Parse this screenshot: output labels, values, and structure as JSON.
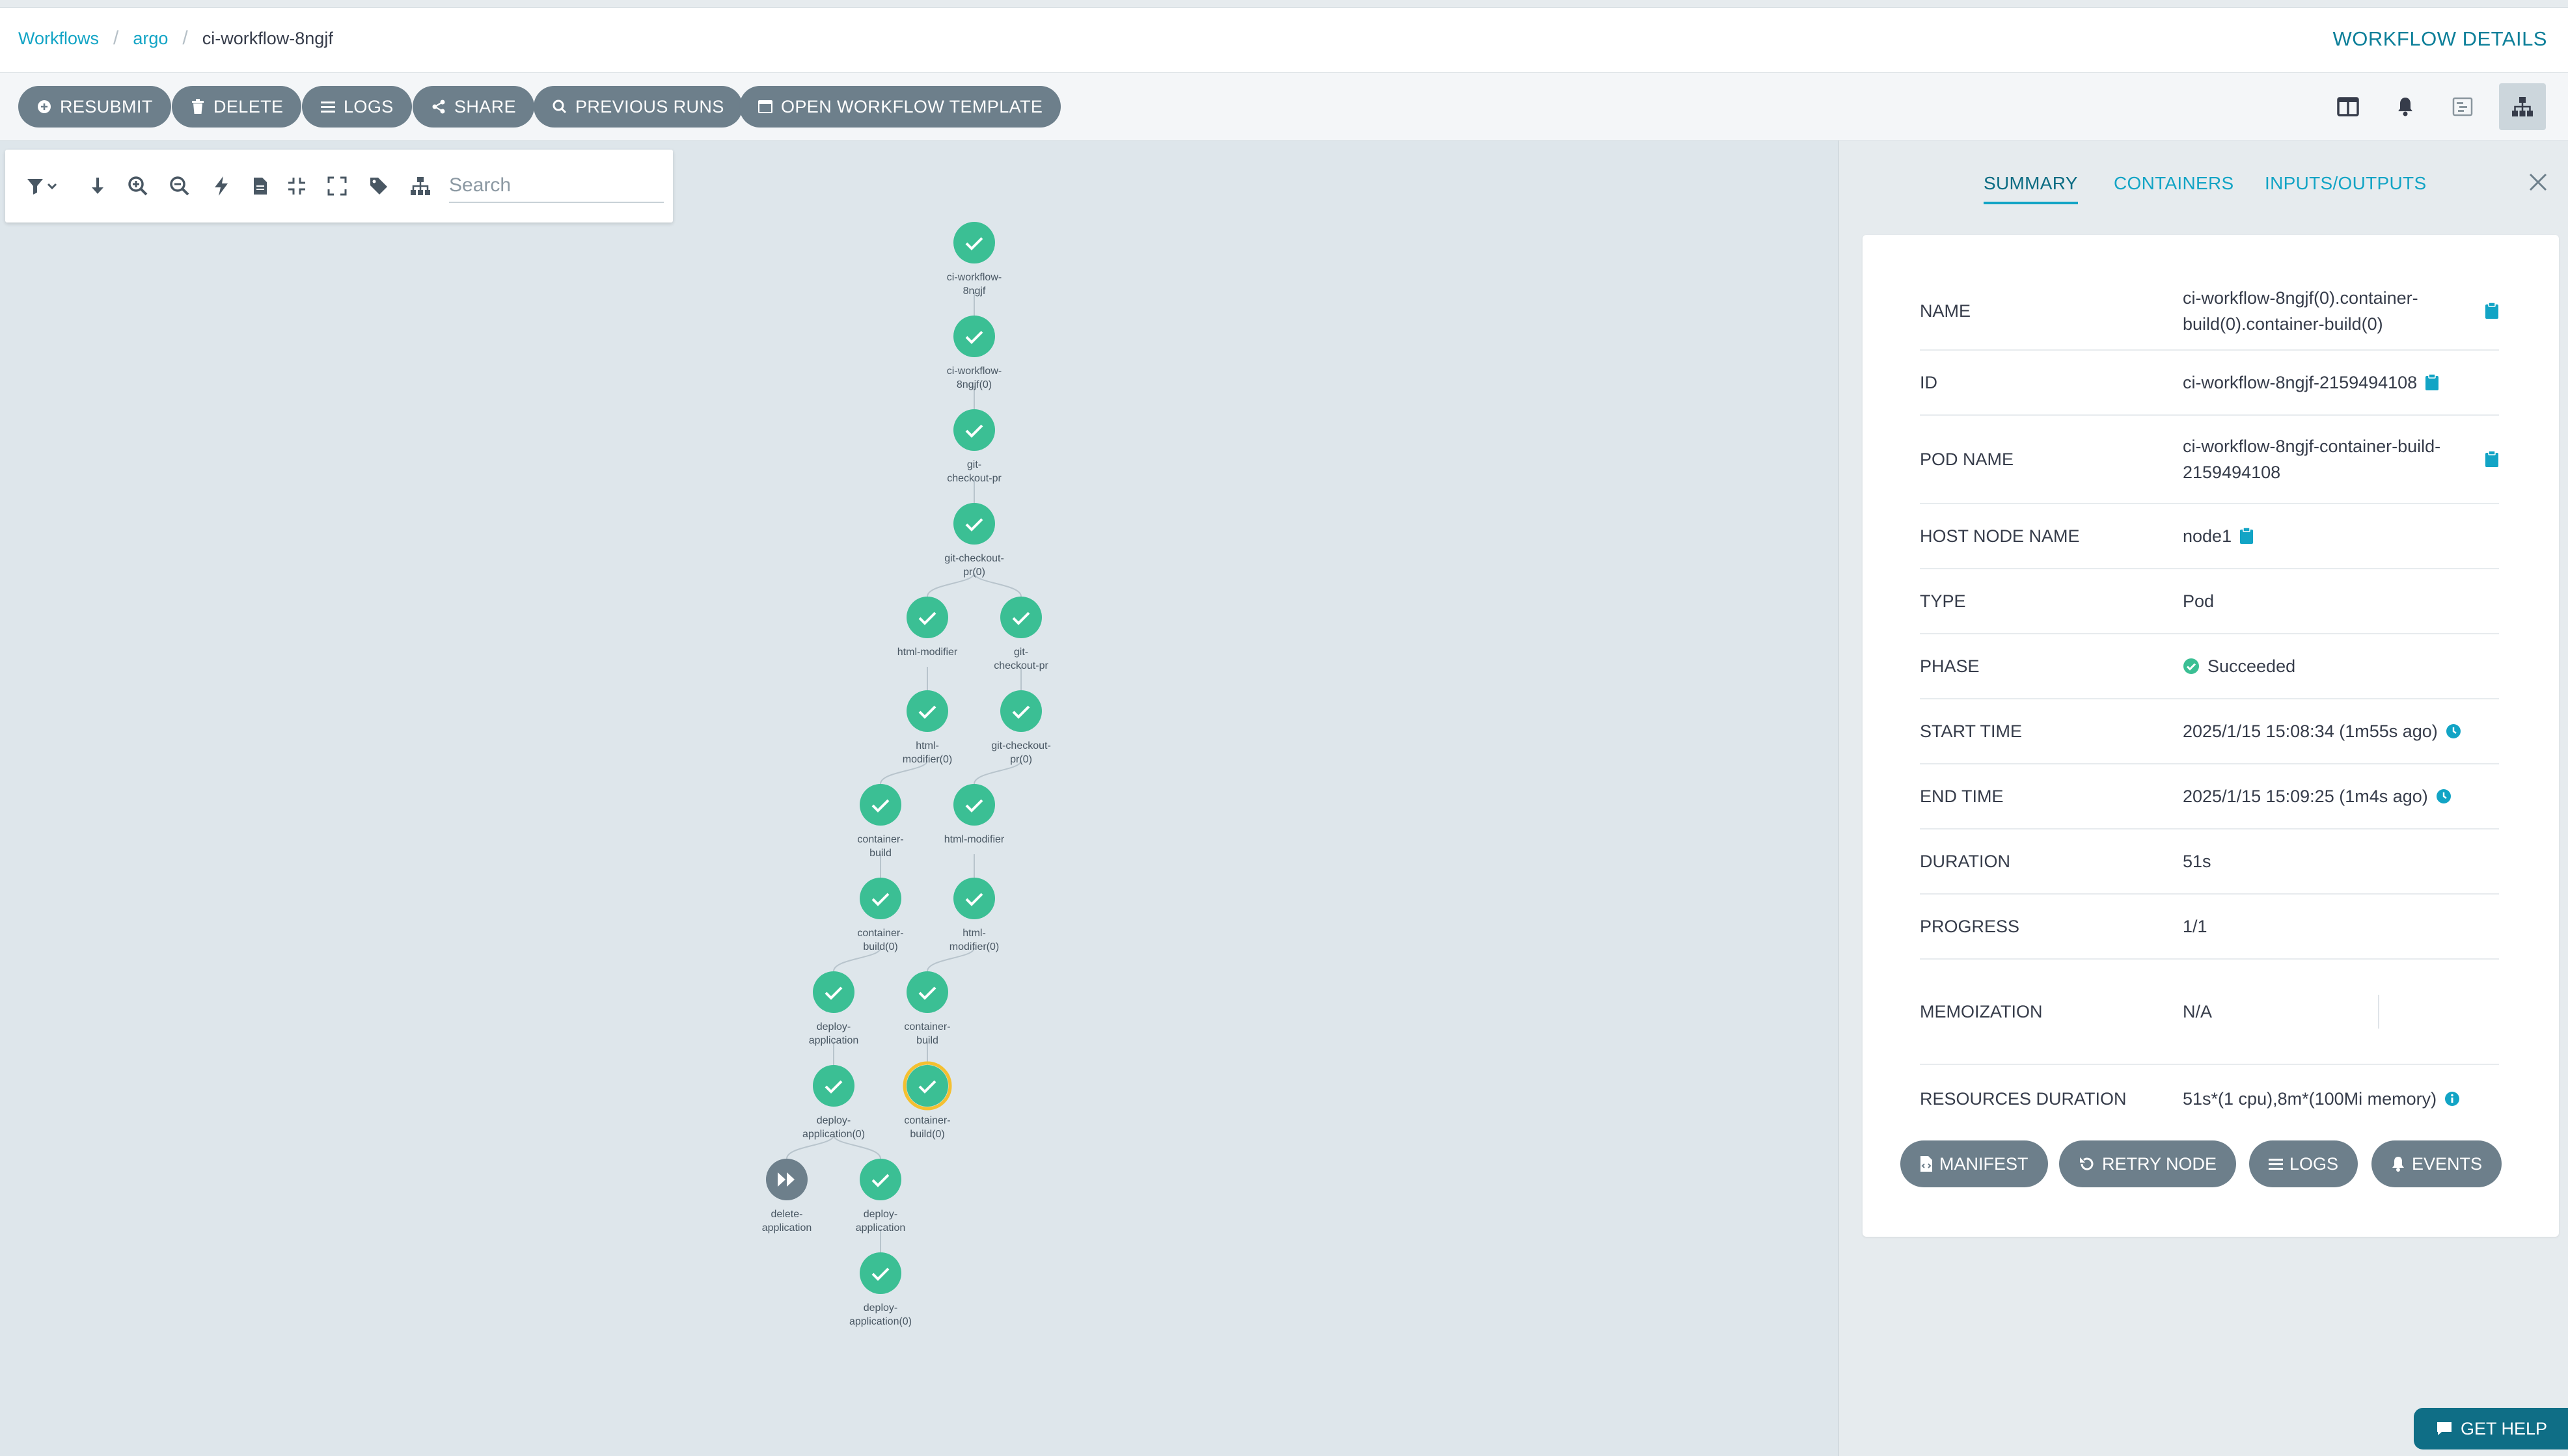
{
  "breadcrumb": {
    "items": [
      "Workflows",
      "argo"
    ],
    "current": "ci-workflow-8ngjf"
  },
  "page_title": "WORKFLOW DETAILS",
  "actions": {
    "resubmit": "RESUBMIT",
    "delete": "DELETE",
    "logs": "LOGS",
    "share": "SHARE",
    "previous_runs": "PREVIOUS RUNS",
    "open_template": "OPEN WORKFLOW TEMPLATE"
  },
  "graph_toolbar": {
    "search_placeholder": "Search"
  },
  "graph": {
    "nodes": [
      {
        "id": "n1",
        "label": [
          "ci-workflow-",
          "8ngjf"
        ],
        "status": "succeeded"
      },
      {
        "id": "n2",
        "label": [
          "ci-workflow-",
          "8ngjf(0)"
        ],
        "status": "succeeded"
      },
      {
        "id": "n3",
        "label": [
          "git-",
          "checkout-pr"
        ],
        "status": "succeeded"
      },
      {
        "id": "n4",
        "label": [
          "git-checkout-",
          "pr(0)"
        ],
        "status": "succeeded"
      },
      {
        "id": "n5",
        "label": [
          "html-modifier"
        ],
        "status": "succeeded"
      },
      {
        "id": "n6",
        "label": [
          "git-",
          "checkout-pr"
        ],
        "status": "succeeded"
      },
      {
        "id": "n7",
        "label": [
          "html-",
          "modifier(0)"
        ],
        "status": "succeeded"
      },
      {
        "id": "n8",
        "label": [
          "git-checkout-",
          "pr(0)"
        ],
        "status": "succeeded"
      },
      {
        "id": "n9",
        "label": [
          "container-",
          "build"
        ],
        "status": "succeeded"
      },
      {
        "id": "n10",
        "label": [
          "html-modifier"
        ],
        "status": "succeeded"
      },
      {
        "id": "n11",
        "label": [
          "container-",
          "build(0)"
        ],
        "status": "succeeded"
      },
      {
        "id": "n12",
        "label": [
          "html-",
          "modifier(0)"
        ],
        "status": "succeeded"
      },
      {
        "id": "n13",
        "label": [
          "deploy-",
          "application"
        ],
        "status": "succeeded"
      },
      {
        "id": "n14",
        "label": [
          "container-",
          "build"
        ],
        "status": "succeeded"
      },
      {
        "id": "n15",
        "label": [
          "deploy-",
          "application(0)"
        ],
        "status": "succeeded"
      },
      {
        "id": "n16",
        "label": [
          "container-",
          "build(0)"
        ],
        "status": "succeeded",
        "selected": true
      },
      {
        "id": "n17",
        "label": [
          "delete-",
          "application"
        ],
        "status": "skipped"
      },
      {
        "id": "n18",
        "label": [
          "deploy-",
          "application"
        ],
        "status": "succeeded"
      },
      {
        "id": "n19",
        "label": [
          "deploy-",
          "application(0)"
        ],
        "status": "succeeded"
      }
    ],
    "edges": [
      [
        "n1",
        "n2"
      ],
      [
        "n2",
        "n3"
      ],
      [
        "n3",
        "n4"
      ],
      [
        "n4",
        "n5"
      ],
      [
        "n4",
        "n6"
      ],
      [
        "n5",
        "n7"
      ],
      [
        "n6",
        "n8"
      ],
      [
        "n7",
        "n9"
      ],
      [
        "n8",
        "n10"
      ],
      [
        "n9",
        "n11"
      ],
      [
        "n10",
        "n12"
      ],
      [
        "n11",
        "n13"
      ],
      [
        "n12",
        "n14"
      ],
      [
        "n13",
        "n15"
      ],
      [
        "n14",
        "n16"
      ],
      [
        "n15",
        "n17"
      ],
      [
        "n15",
        "n18"
      ],
      [
        "n18",
        "n19"
      ]
    ]
  },
  "panel": {
    "tabs": [
      "SUMMARY",
      "CONTAINERS",
      "INPUTS/OUTPUTS"
    ],
    "fields": {
      "name": {
        "label": "NAME",
        "value": "ci-workflow-8ngjf(0).container-build(0).container-build(0)"
      },
      "id": {
        "label": "ID",
        "value": "ci-workflow-8ngjf-2159494108"
      },
      "pod_name": {
        "label": "POD NAME",
        "value": "ci-workflow-8ngjf-container-build-2159494108"
      },
      "host_node_name": {
        "label": "HOST NODE NAME",
        "value": "node1"
      },
      "type": {
        "label": "TYPE",
        "value": "Pod"
      },
      "phase": {
        "label": "PHASE",
        "value": "Succeeded"
      },
      "start_time": {
        "label": "START TIME",
        "value": "2025/1/15 15:08:34 (1m55s ago)"
      },
      "end_time": {
        "label": "END TIME",
        "value": "2025/1/15 15:09:25 (1m4s ago)"
      },
      "duration": {
        "label": "DURATION",
        "value": "51s"
      },
      "progress": {
        "label": "PROGRESS",
        "value": "1/1"
      },
      "memoization": {
        "label": "MEMOIZATION",
        "value": "N/A"
      },
      "resources_duration": {
        "label": "RESOURCES DURATION",
        "value": "51s*(1 cpu),8m*(100Mi memory)"
      }
    },
    "buttons": {
      "manifest": "MANIFEST",
      "retry_node": "RETRY NODE",
      "logs": "LOGS",
      "events": "EVENTS"
    }
  },
  "help": "GET HELP",
  "colors": {
    "accent": "#12a4c5",
    "success": "#3bbf94",
    "button": "#6d7f8b",
    "selected_ring": "#f4c030",
    "skipped": "#6d7f8b"
  }
}
